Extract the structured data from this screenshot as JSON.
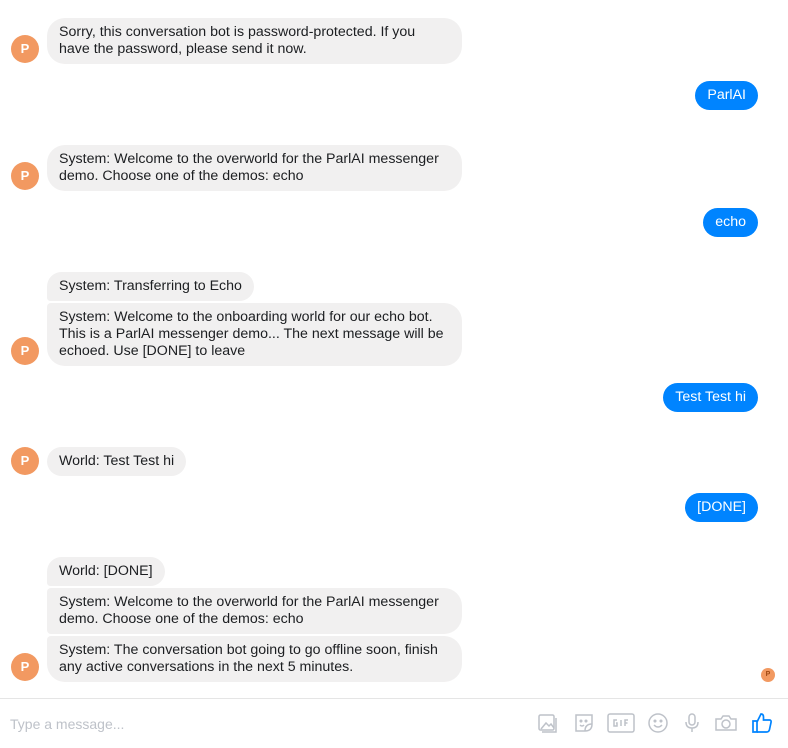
{
  "avatar_letter": "P",
  "messages": [
    {
      "text": "Sorry, this conversation bot is password-protected. If you\nhave the password, please send it now."
    },
    {
      "text": "ParlAI"
    },
    {
      "text": "System: Welcome to the overworld for the ParlAI messenger\ndemo. Choose one of the demos: echo"
    },
    {
      "text": "echo"
    },
    {
      "text": "System: Transferring to Echo"
    },
    {
      "text": "System: Welcome to the onboarding world for our echo bot.\nThis is a ParlAI messenger demo... The next message will be\nechoed. Use [DONE] to leave"
    },
    {
      "text": "Test Test hi"
    },
    {
      "text": "World: Test Test hi"
    },
    {
      "text": "[DONE]"
    },
    {
      "text": "World: [DONE]"
    },
    {
      "text": "System: Welcome to the overworld for the ParlAI messenger\ndemo. Choose one of the demos: echo"
    },
    {
      "text": "System: The conversation bot going to go offline soon, finish\nany active conversations in the next 5 minutes."
    }
  ],
  "composer": {
    "placeholder": "Type a message..."
  },
  "colors": {
    "outgoing_bubble": "#0084ff",
    "incoming_bubble": "#f1f0f0",
    "avatar": "#f29961",
    "like": "#0084ff",
    "tool_icon": "#bec2c9"
  },
  "toolbar_icons": [
    "image-icon",
    "sticker-icon",
    "gif-icon",
    "emoji-icon",
    "microphone-icon",
    "camera-icon",
    "thumbs-up-icon"
  ]
}
